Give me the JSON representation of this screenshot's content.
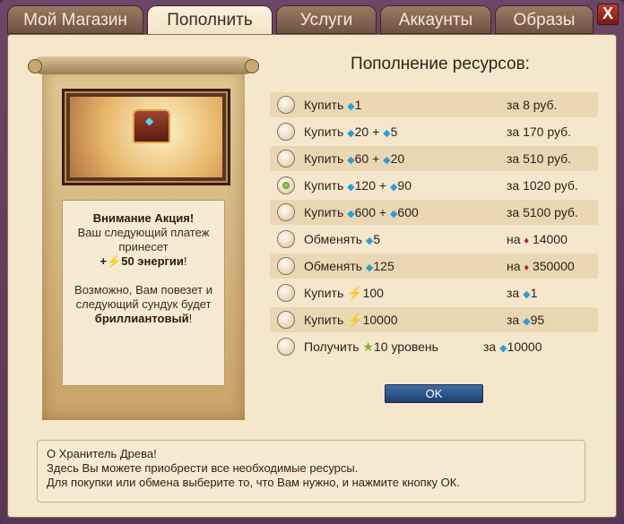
{
  "tabs": [
    "Мой Магазин",
    "Пополнить",
    "Услуги",
    "Аккаунты",
    "Образы"
  ],
  "close_label": "X",
  "promo": {
    "line1": "Внимание Акция!",
    "line2": "Ваш следующий платеж",
    "line3": "принесет",
    "bonus_prefix": "+",
    "bonus_amount": "50 энергии",
    "bonus_suffix": "!",
    "line4": "Возможно, Вам повезет и",
    "line5": "следующий сундук будет",
    "diamond_word": "бриллиантовый",
    "diamond_suffix": "!"
  },
  "title": "Пополнение ресурсов:",
  "rows": [
    {
      "a1": "Купить",
      "a2": "1",
      "a3": "",
      "p1": "за 8 руб.",
      "checked": false
    },
    {
      "a1": "Купить",
      "a2": "20 +",
      "a3": "5",
      "p1": "за 170 руб.",
      "checked": false
    },
    {
      "a1": "Купить",
      "a2": "60 +",
      "a3": "20",
      "p1": "за 510 руб.",
      "checked": false
    },
    {
      "a1": "Купить",
      "a2": "120 +",
      "a3": "90",
      "p1": "за 1020 руб.",
      "checked": true
    },
    {
      "a1": "Купить",
      "a2": "600 +",
      "a3": "600",
      "p1": "за 5100 руб.",
      "checked": false
    },
    {
      "a1": "Обменять",
      "a2": "5",
      "a3": "",
      "p1": "на",
      "p2": "14000",
      "checked": false
    },
    {
      "a1": "Обменять",
      "a2": "125",
      "a3": "",
      "p1": "на",
      "p2": "350000",
      "checked": false
    },
    {
      "a1": "Купить",
      "a2": "100",
      "a3": "",
      "p1": "за",
      "p2": "1",
      "checked": false
    },
    {
      "a1": "Купить",
      "a2": "10000",
      "a3": "",
      "p1": "за",
      "p2": "95",
      "checked": false
    },
    {
      "a1": "Получить",
      "a2": "10 уровень",
      "a3": "",
      "p1": "за",
      "p2": "10000",
      "checked": false
    }
  ],
  "ok_label": "OK",
  "info": {
    "line1": "О Хранитель Древа!",
    "line2": "Здесь Вы можете приобрести все необходимые ресурсы.",
    "line3": "Для покупки или обмена выберите то, что Вам нужно, и нажмите кнопку ОК."
  }
}
